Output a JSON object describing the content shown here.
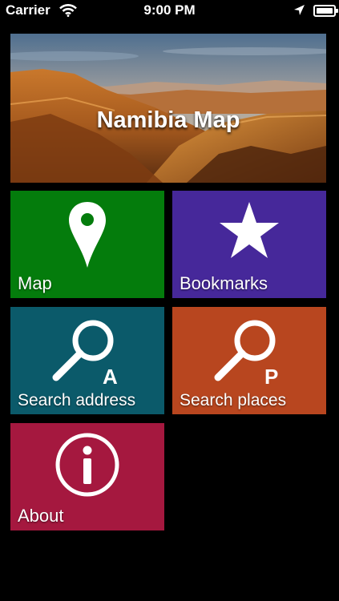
{
  "status_bar": {
    "carrier": "Carrier",
    "time": "9:00 PM",
    "icons": [
      "wifi-icon",
      "location-arrow-icon",
      "battery-icon"
    ]
  },
  "banner": {
    "title": "Namibia Map"
  },
  "tiles": [
    {
      "label": "Map",
      "icon": "map-pin-icon",
      "color": "#047c0c"
    },
    {
      "label": "Bookmarks",
      "icon": "star-icon",
      "color": "#46289a"
    },
    {
      "label": "Search address",
      "icon": "search-address-icon",
      "icon_letter": "A",
      "color": "#0b5a6a"
    },
    {
      "label": "Search places",
      "icon": "search-places-icon",
      "icon_letter": "P",
      "color": "#b8461f"
    },
    {
      "label": "About",
      "icon": "info-icon",
      "color": "#a5183f"
    }
  ],
  "colors": {
    "background": "#000000"
  }
}
